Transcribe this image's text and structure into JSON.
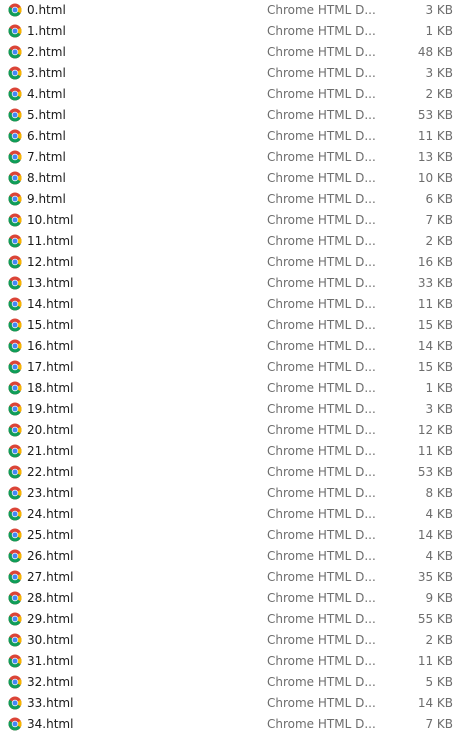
{
  "files": [
    {
      "name": "0.html",
      "type": "Chrome HTML D...",
      "size": "3 KB",
      "icon": "chrome-icon"
    },
    {
      "name": "1.html",
      "type": "Chrome HTML D...",
      "size": "1 KB",
      "icon": "chrome-icon"
    },
    {
      "name": "2.html",
      "type": "Chrome HTML D...",
      "size": "48 KB",
      "icon": "chrome-icon"
    },
    {
      "name": "3.html",
      "type": "Chrome HTML D...",
      "size": "3 KB",
      "icon": "chrome-icon"
    },
    {
      "name": "4.html",
      "type": "Chrome HTML D...",
      "size": "2 KB",
      "icon": "chrome-icon"
    },
    {
      "name": "5.html",
      "type": "Chrome HTML D...",
      "size": "53 KB",
      "icon": "chrome-icon"
    },
    {
      "name": "6.html",
      "type": "Chrome HTML D...",
      "size": "11 KB",
      "icon": "chrome-icon"
    },
    {
      "name": "7.html",
      "type": "Chrome HTML D...",
      "size": "13 KB",
      "icon": "chrome-icon"
    },
    {
      "name": "8.html",
      "type": "Chrome HTML D...",
      "size": "10 KB",
      "icon": "chrome-icon"
    },
    {
      "name": "9.html",
      "type": "Chrome HTML D...",
      "size": "6 KB",
      "icon": "chrome-icon"
    },
    {
      "name": "10.html",
      "type": "Chrome HTML D...",
      "size": "7 KB",
      "icon": "chrome-icon"
    },
    {
      "name": "11.html",
      "type": "Chrome HTML D...",
      "size": "2 KB",
      "icon": "chrome-icon"
    },
    {
      "name": "12.html",
      "type": "Chrome HTML D...",
      "size": "16 KB",
      "icon": "chrome-icon"
    },
    {
      "name": "13.html",
      "type": "Chrome HTML D...",
      "size": "33 KB",
      "icon": "chrome-icon"
    },
    {
      "name": "14.html",
      "type": "Chrome HTML D...",
      "size": "11 KB",
      "icon": "chrome-icon"
    },
    {
      "name": "15.html",
      "type": "Chrome HTML D...",
      "size": "15 KB",
      "icon": "chrome-icon"
    },
    {
      "name": "16.html",
      "type": "Chrome HTML D...",
      "size": "14 KB",
      "icon": "chrome-icon"
    },
    {
      "name": "17.html",
      "type": "Chrome HTML D...",
      "size": "15 KB",
      "icon": "chrome-icon"
    },
    {
      "name": "18.html",
      "type": "Chrome HTML D...",
      "size": "1 KB",
      "icon": "chrome-icon"
    },
    {
      "name": "19.html",
      "type": "Chrome HTML D...",
      "size": "3 KB",
      "icon": "chrome-icon"
    },
    {
      "name": "20.html",
      "type": "Chrome HTML D...",
      "size": "12 KB",
      "icon": "chrome-icon"
    },
    {
      "name": "21.html",
      "type": "Chrome HTML D...",
      "size": "11 KB",
      "icon": "chrome-icon"
    },
    {
      "name": "22.html",
      "type": "Chrome HTML D...",
      "size": "53 KB",
      "icon": "chrome-icon"
    },
    {
      "name": "23.html",
      "type": "Chrome HTML D...",
      "size": "8 KB",
      "icon": "chrome-icon"
    },
    {
      "name": "24.html",
      "type": "Chrome HTML D...",
      "size": "4 KB",
      "icon": "chrome-icon"
    },
    {
      "name": "25.html",
      "type": "Chrome HTML D...",
      "size": "14 KB",
      "icon": "chrome-icon"
    },
    {
      "name": "26.html",
      "type": "Chrome HTML D...",
      "size": "4 KB",
      "icon": "chrome-icon"
    },
    {
      "name": "27.html",
      "type": "Chrome HTML D...",
      "size": "35 KB",
      "icon": "chrome-icon"
    },
    {
      "name": "28.html",
      "type": "Chrome HTML D...",
      "size": "9 KB",
      "icon": "chrome-icon"
    },
    {
      "name": "29.html",
      "type": "Chrome HTML D...",
      "size": "55 KB",
      "icon": "chrome-icon"
    },
    {
      "name": "30.html",
      "type": "Chrome HTML D...",
      "size": "2 KB",
      "icon": "chrome-icon"
    },
    {
      "name": "31.html",
      "type": "Chrome HTML D...",
      "size": "11 KB",
      "icon": "chrome-icon"
    },
    {
      "name": "32.html",
      "type": "Chrome HTML D...",
      "size": "5 KB",
      "icon": "chrome-icon"
    },
    {
      "name": "33.html",
      "type": "Chrome HTML D...",
      "size": "14 KB",
      "icon": "chrome-icon"
    },
    {
      "name": "34.html",
      "type": "Chrome HTML D...",
      "size": "7 KB",
      "icon": "chrome-icon"
    }
  ],
  "colors": {
    "chrome_red": "#DB4437",
    "chrome_yellow": "#F4B400",
    "chrome_green": "#0F9D58",
    "chrome_blue": "#4285F4"
  }
}
